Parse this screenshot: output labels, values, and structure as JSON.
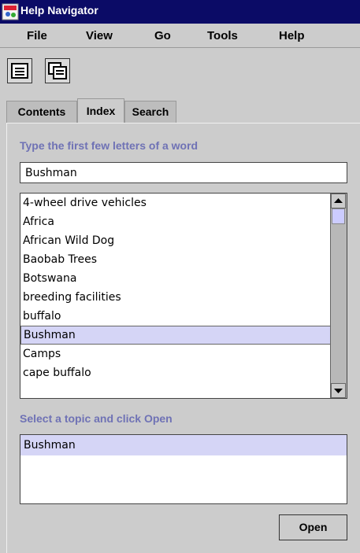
{
  "window": {
    "title": "Help Navigator"
  },
  "menu": {
    "items": [
      "File",
      "View",
      "Go",
      "Tools",
      "Help"
    ]
  },
  "toolbar": {
    "buttons": [
      "hide-navigator-icon",
      "new-window-icon"
    ]
  },
  "tabs": [
    {
      "label": "Contents",
      "selected": false
    },
    {
      "label": "Index",
      "selected": true
    },
    {
      "label": "Search",
      "selected": false
    }
  ],
  "index": {
    "prompt": "Type the first few letters of a word",
    "search_value": "Bushman",
    "items": [
      "4-wheel drive vehicles",
      "Africa",
      "African Wild Dog",
      "Baobab Trees",
      "Botswana",
      "breeding facilities",
      "buffalo",
      "Bushman",
      "Camps",
      "cape buffalo"
    ],
    "selected": "Bushman"
  },
  "topics": {
    "prompt": "Select a topic and click Open",
    "items": [
      "Bushman"
    ]
  },
  "buttons": {
    "open": "Open"
  },
  "colors": {
    "titlebar": "#0b0b66",
    "accent_text": "#6f72b5",
    "selection": "#d5d5f6"
  }
}
